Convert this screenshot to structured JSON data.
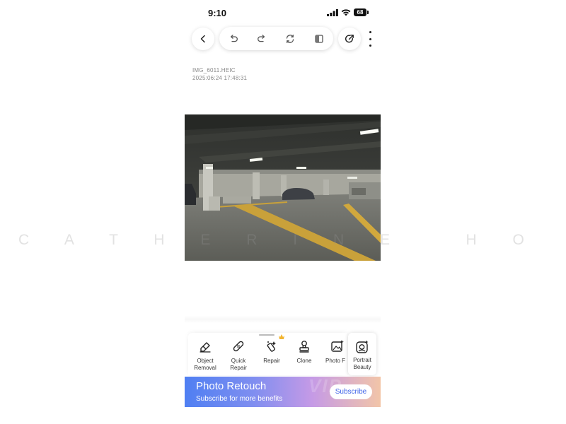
{
  "status_bar": {
    "time": "9:10",
    "battery": "68",
    "icons": [
      "signal-icon",
      "wifi-icon",
      "battery-icon"
    ]
  },
  "toolbar": {
    "icons": [
      "back-arrow-icon",
      "undo-icon",
      "redo-icon",
      "reset-icon",
      "compare-icon",
      "share-icon",
      "more-icon"
    ]
  },
  "file": {
    "name": "IMG_6011.HEIC",
    "date": "2025:06:24 17:48:31"
  },
  "watermark": "C A T H E R I N E   H O   M E I   Y O K E",
  "tools": [
    {
      "label": "Object\nRemoval",
      "icon": "eraser-icon"
    },
    {
      "label": "Quick\nRepair",
      "icon": "bandage-icon"
    },
    {
      "label": "Repair",
      "icon": "repair-brush-icon"
    },
    {
      "label": "Clone",
      "icon": "stamp-icon"
    },
    {
      "label": "Photo F",
      "icon": "photo-enhance-icon"
    }
  ],
  "portrait": {
    "label": "Portrait\nBeauty",
    "icon": "portrait-icon"
  },
  "banner": {
    "title": "Photo Retouch",
    "subtitle": "Subscribe for more benefits",
    "button": "Subscribe"
  },
  "colors": {
    "accent": "#3e63e8",
    "banner_start": "#4f7ff2",
    "banner_end": "#f2c5a8"
  }
}
